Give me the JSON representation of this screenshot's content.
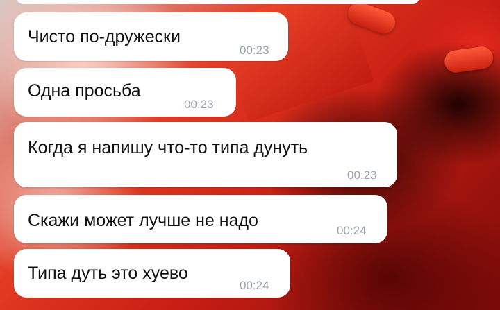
{
  "colors": {
    "bubble": "#ffffff",
    "text": "#111111",
    "timestamp": "#9aa3ad",
    "background_accent": "#e23a22"
  },
  "messages": [
    {
      "text": "Чисто по-дружески",
      "time": "00:23"
    },
    {
      "text": "Одна просьба",
      "time": "00:23"
    },
    {
      "text": "Когда я напишу что-то типа дунуть",
      "time": "00:23"
    },
    {
      "text": "Скажи может лучше не надо",
      "time": "00:24"
    },
    {
      "text": "Типа дуть это хуево",
      "time": "00:24"
    }
  ]
}
